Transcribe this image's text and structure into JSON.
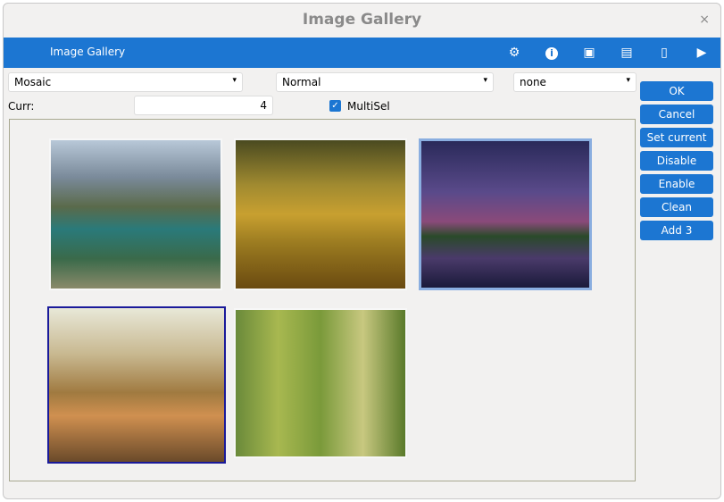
{
  "window": {
    "title": "Image Gallery",
    "close": "×"
  },
  "toolbar": {
    "title": "Image Gallery"
  },
  "controls": {
    "mode": "Mosaic",
    "style": "Normal",
    "filter": "none",
    "curr_label": "Curr:",
    "curr_value": "4",
    "multisel_label": "MultiSel",
    "multisel_checked": true
  },
  "buttons": [
    "OK",
    "Cancel",
    "Set current",
    "Disable",
    "Enable",
    "Clean",
    "Add 3"
  ],
  "images": [
    "lake-mountains",
    "sunset-hills",
    "lightning-storm",
    "cat-autumn",
    "forest-trees"
  ],
  "colors": {
    "accent": "#1c76d2"
  }
}
